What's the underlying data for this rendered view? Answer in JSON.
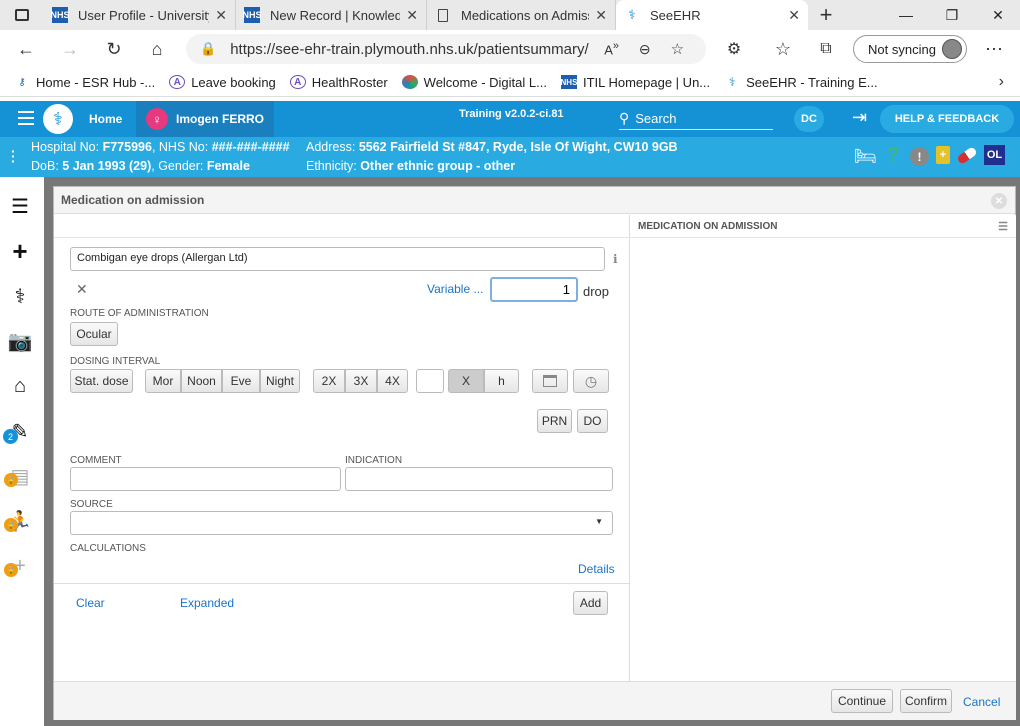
{
  "browser": {
    "tabs": [
      {
        "title": "User Profile - University",
        "icon": "nhs-icon"
      },
      {
        "title": "New Record | Knowledg",
        "icon": "nhs-icon"
      },
      {
        "title": "Medications on Admiss",
        "icon": "page-icon"
      },
      {
        "title": "SeeEHR",
        "icon": "seeehr-icon"
      }
    ],
    "url": "https://see-ehr-train.plymouth.nhs.uk/patientsummary/...",
    "sync_label": "Not syncing",
    "bookmarks": [
      "Home - ESR Hub -...",
      "Leave booking",
      "HealthRoster",
      "Welcome - Digital L...",
      "ITIL Homepage | Un...",
      "SeeEHR - Training E..."
    ]
  },
  "app": {
    "home_label": "Home",
    "patient_name": "Imogen FERRO",
    "version": "Training v2.0.2-ci.81",
    "search_label": "Search",
    "user_initials": "DC",
    "help_label": "HELP & FEEDBACK"
  },
  "patient": {
    "hospital_label": "Hospital No:",
    "hospital_no": "F775996",
    "nhs_label": "NHS No:",
    "nhs_no": "###-###-####",
    "address_label": "Address:",
    "address": "5562 Fairfield St #847, Ryde, Isle Of Wight, CW10 9GB",
    "dob_label": "DoB:",
    "dob": "5 Jan 1993 (29)",
    "gender_label": "Gender:",
    "gender": "Female",
    "ethnicity_label": "Ethnicity:",
    "ethnicity": "Other ethnic group - other",
    "ol_badge": "OL"
  },
  "sidebar": {
    "badge_count": "2"
  },
  "modal": {
    "title": "Medication on admission",
    "drug_name": "Combigan eye drops (Allergan Ltd)",
    "variable_link": "Variable ...",
    "dose_value": "1",
    "dose_unit": "drop",
    "route_label": "ROUTE OF ADMINISTRATION",
    "route_button": "Ocular",
    "interval_label": "DOSING INTERVAL",
    "stat_dose": "Stat. dose",
    "times": [
      "Mor",
      "Noon",
      "Eve",
      "Night"
    ],
    "freq": [
      "2X",
      "3X",
      "4X"
    ],
    "x_label": "X",
    "h_label": "h",
    "prn": "PRN",
    "do": "DO",
    "comment_label": "COMMENT",
    "indication_label": "INDICATION",
    "source_label": "SOURCE",
    "calculations_label": "CALCULATIONS",
    "details_link": "Details",
    "clear_link": "Clear",
    "expanded_link": "Expanded",
    "add_button": "Add",
    "right_panel_title": "MEDICATION ON ADMISSION",
    "continue_button": "Continue",
    "confirm_button": "Confirm",
    "cancel_link": "Cancel"
  }
}
